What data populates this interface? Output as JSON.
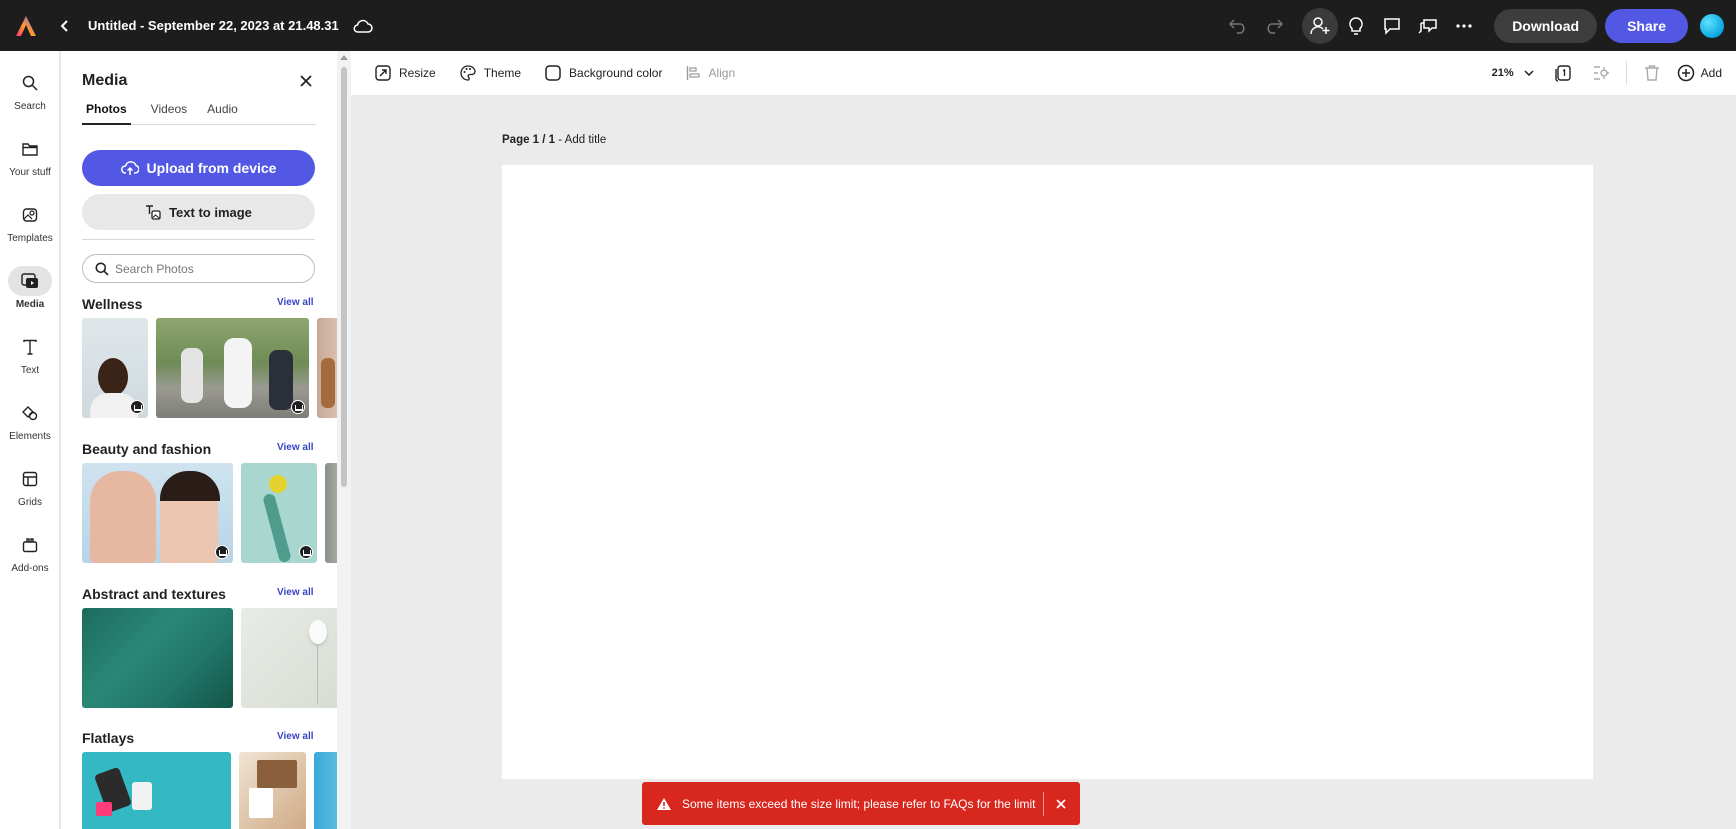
{
  "header": {
    "doc_title": "Untitled - September 22, 2023 at 21.48.31",
    "download_label": "Download",
    "share_label": "Share"
  },
  "rail": {
    "items": [
      {
        "label": "Search",
        "icon": "search-icon"
      },
      {
        "label": "Your stuff",
        "icon": "folder-icon"
      },
      {
        "label": "Templates",
        "icon": "templates-icon"
      },
      {
        "label": "Media",
        "icon": "media-icon",
        "active": true
      },
      {
        "label": "Text",
        "icon": "text-icon"
      },
      {
        "label": "Elements",
        "icon": "elements-icon"
      },
      {
        "label": "Grids",
        "icon": "grids-icon"
      },
      {
        "label": "Add-ons",
        "icon": "addons-icon"
      }
    ]
  },
  "panel": {
    "title": "Media",
    "tabs": [
      {
        "label": "Photos",
        "active": true
      },
      {
        "label": "Videos"
      },
      {
        "label": "Audio"
      }
    ],
    "upload_label": "Upload from device",
    "t2i_label": "Text to image",
    "search_placeholder": "Search Photos",
    "view_all": "View all",
    "sections": [
      {
        "title": "Wellness"
      },
      {
        "title": "Beauty and fashion"
      },
      {
        "title": "Abstract and textures"
      },
      {
        "title": "Flatlays"
      }
    ]
  },
  "toolbar": {
    "resize": "Resize",
    "theme": "Theme",
    "background_color": "Background color",
    "align": "Align",
    "zoom": "21%",
    "add": "Add"
  },
  "canvas": {
    "page_indicator": "Page 1 / 1",
    "separator": " - ",
    "add_title": "Add title"
  },
  "toast": {
    "message": "Some items exceed the size limit; please refer to FAQs for the limit"
  },
  "colors": {
    "accent": "#5258e4",
    "topbar": "#1d1d1d",
    "error": "#d7271e"
  }
}
